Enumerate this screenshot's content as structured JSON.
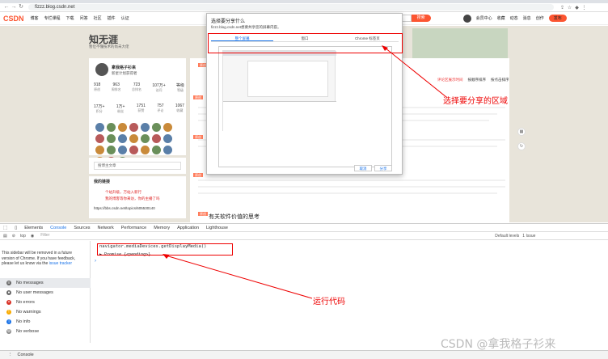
{
  "browser": {
    "url": "fizzz.blog.csdn.net"
  },
  "site": {
    "logo": "CSDN",
    "nav": [
      "博客",
      "专栏课程",
      "下载",
      "问答",
      "社区",
      "插件",
      "认证"
    ],
    "search_button": "搜索",
    "right": [
      "会员中心",
      "收藏",
      "动态",
      "消息",
      "创作"
    ],
    "publish": "发布"
  },
  "blog": {
    "title": "知无涯",
    "subtitle": "暂位不懂技术的尚未大佬"
  },
  "profile": {
    "name": "拿我格子衫来",
    "sub": "新星计划获得者",
    "stats_top": [
      {
        "value": "918",
        "label": "原创"
      },
      {
        "value": "963",
        "label": "周排名"
      },
      {
        "value": "723",
        "label": "总排名"
      },
      {
        "value": "107万+",
        "label": "访问"
      },
      {
        "value": "等级",
        "label": "等级"
      }
    ],
    "stats_bottom": [
      {
        "value": "17万+",
        "label": "积分"
      },
      {
        "value": "1万+",
        "label": "粉丝"
      },
      {
        "value": "1751",
        "label": "获赞"
      },
      {
        "value": "757",
        "label": "评论"
      },
      {
        "value": "1067",
        "label": "收藏"
      }
    ]
  },
  "sidebar": {
    "search_placeholder": "搜博主文章",
    "section_title": "我的链接",
    "red1": "个站升级，万站入新行",
    "red2": "我的博客等你来访，你的主播了吗",
    "url": "https://bbs.csdn.net/topics/605530140"
  },
  "main": {
    "article_title": "有关软件价值的思考",
    "tabs": [
      "评论区展示时间",
      "按顺序排序",
      "按点击排序"
    ]
  },
  "dialog": {
    "title": "选择要分享什么",
    "subtitle": "fizzz.blog.csdn.net想要共享您的屏幕内容。",
    "tabs": [
      "整个屏幕",
      "窗口",
      "Chrome 标签页"
    ],
    "active_tab": 0,
    "cancel": "取消",
    "share": "分享"
  },
  "annotations": {
    "share_area": "选择要分享的区域",
    "run_code": "运行代码"
  },
  "devtools": {
    "tabs": [
      "Elements",
      "Console",
      "Sources",
      "Network",
      "Performance",
      "Memory",
      "Application",
      "Lighthouse"
    ],
    "active_tab": "Console",
    "context": "top",
    "filter_placeholder": "Filter",
    "levels": "Default levels",
    "issues": "1 Issue",
    "sidebar_note_1": "This sidebar will be removed in a future",
    "sidebar_note_2": "version of Chrome. If you have feedback,",
    "sidebar_note_3": "please let us know via the",
    "sidebar_note_link": "issue tracker",
    "sidebar_items": [
      {
        "label": "No messages",
        "icon": "list-icon",
        "color": "#666"
      },
      {
        "label": "No user messages",
        "icon": "user-icon",
        "color": "#666"
      },
      {
        "label": "No errors",
        "icon": "error-icon",
        "color": "#d93025"
      },
      {
        "label": "No warnings",
        "icon": "warning-icon",
        "color": "#f9ab00"
      },
      {
        "label": "No info",
        "icon": "info-icon",
        "color": "#1a73e8"
      },
      {
        "label": "No verbose",
        "icon": "verbose-icon",
        "color": "#888"
      }
    ],
    "command": "navigator.mediaDevices.getDisplayMedia()",
    "result": "▶ Promise {<pending>}",
    "drawer_tab": "Console"
  },
  "watermark": "CSDN @拿我格子衫来"
}
